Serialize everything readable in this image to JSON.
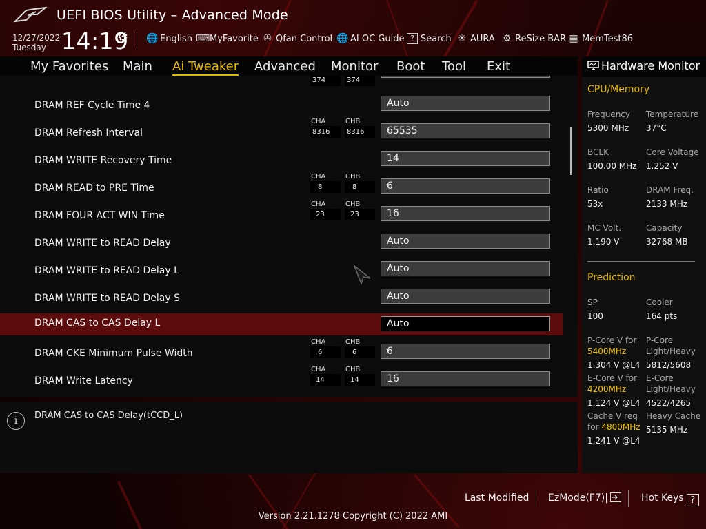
{
  "app": {
    "title": "UEFI BIOS Utility – Advanced Mode"
  },
  "datetime": {
    "date": "12/27/2022",
    "day": "Tuesday",
    "time": "14:19"
  },
  "toolbar": [
    {
      "name": "language",
      "icon": "globe-icon",
      "glyph": "🌐",
      "label": "English"
    },
    {
      "name": "myfavorite",
      "icon": "keyboard-icon",
      "glyph": "⌨",
      "label": "MyFavorite"
    },
    {
      "name": "qfan-control",
      "icon": "fan-icon",
      "glyph": "✇",
      "label": "Qfan Control"
    },
    {
      "name": "ai-oc-guide",
      "icon": "globe-icon",
      "glyph": "🌐",
      "label": "AI OC Guide"
    },
    {
      "name": "search",
      "icon": "question-icon",
      "glyph": "?",
      "label": "Search"
    },
    {
      "name": "aura",
      "icon": "sun-icon",
      "glyph": "☀",
      "label": "AURA"
    },
    {
      "name": "resize-bar",
      "icon": "chip-icon",
      "glyph": "⚙",
      "label": "ReSize BAR"
    },
    {
      "name": "memtest86",
      "icon": "memory-icon",
      "glyph": "▦",
      "label": "MemTest86"
    }
  ],
  "tabs": [
    {
      "label": "My Favorites",
      "active": false
    },
    {
      "label": "Main",
      "active": false
    },
    {
      "label": "Ai Tweaker",
      "active": true
    },
    {
      "label": "Advanced",
      "active": false
    },
    {
      "label": "Monitor",
      "active": false
    },
    {
      "label": "Boot",
      "active": false
    },
    {
      "label": "Tool",
      "active": false
    },
    {
      "label": "Exit",
      "active": false
    }
  ],
  "settings": {
    "partial_top": {
      "cha": "374",
      "chb": "374"
    },
    "channel_labels": {
      "a": "CHA",
      "b": "CHB"
    },
    "rows": [
      {
        "label": "DRAM REF Cycle Time 4",
        "value": "Auto",
        "cha": null,
        "chb": null,
        "selected": false
      },
      {
        "label": "DRAM Refresh Interval",
        "value": "65535",
        "cha": "8316",
        "chb": "8316",
        "selected": false
      },
      {
        "label": "DRAM WRITE Recovery Time",
        "value": "14",
        "cha": null,
        "chb": null,
        "selected": false
      },
      {
        "label": "DRAM READ to PRE Time",
        "value": "6",
        "cha": "8",
        "chb": "8",
        "selected": false
      },
      {
        "label": "DRAM FOUR ACT WIN Time",
        "value": "16",
        "cha": "23",
        "chb": "23",
        "selected": false
      },
      {
        "label": "DRAM WRITE to READ Delay",
        "value": "Auto",
        "cha": null,
        "chb": null,
        "selected": false
      },
      {
        "label": "DRAM WRITE to READ Delay L",
        "value": "Auto",
        "cha": null,
        "chb": null,
        "selected": false
      },
      {
        "label": "DRAM WRITE to READ Delay S",
        "value": "Auto",
        "cha": null,
        "chb": null,
        "selected": false
      },
      {
        "label": "DRAM CAS to CAS Delay L",
        "value": "Auto",
        "cha": null,
        "chb": null,
        "selected": true
      },
      {
        "label": "DRAM CKE Minimum Pulse Width",
        "value": "6",
        "cha": "6",
        "chb": "6",
        "selected": false
      },
      {
        "label": "DRAM Write Latency",
        "value": "16",
        "cha": "14",
        "chb": "14",
        "selected": false
      }
    ]
  },
  "help": {
    "text": "DRAM CAS to CAS Delay(tCCD_L)"
  },
  "hardware_monitor": {
    "title": "Hardware Monitor",
    "cpu_memory": {
      "title": "CPU/Memory",
      "items": [
        {
          "label": "Frequency",
          "value": "5300 MHz"
        },
        {
          "label": "Temperature",
          "value": "37°C"
        },
        {
          "label": "BCLK",
          "value": "100.00 MHz"
        },
        {
          "label": "Core Voltage",
          "value": "1.252 V"
        },
        {
          "label": "Ratio",
          "value": "53x"
        },
        {
          "label": "DRAM Freq.",
          "value": "2133 MHz"
        },
        {
          "label": "MC Volt.",
          "value": "1.190 V"
        },
        {
          "label": "Capacity",
          "value": "32768 MB"
        }
      ]
    },
    "prediction": {
      "title": "Prediction",
      "sp_label": "SP",
      "sp_value": "100",
      "cooler_label": "Cooler",
      "cooler_value": "164 pts",
      "pcore_v_label": "P-Core V for",
      "pcore_v_freq": "5400MHz",
      "pcore_v_value": "1.304 V @L4",
      "pcore_lh_label1": "P-Core",
      "pcore_lh_label2": "Light/Heavy",
      "pcore_lh_value": "5812/5608",
      "ecore_v_label": "E-Core V for",
      "ecore_v_freq": "4200MHz",
      "ecore_v_value": "1.124 V @L4",
      "ecore_lh_label1": "E-Core",
      "ecore_lh_label2": "Light/Heavy",
      "ecore_lh_value": "4522/4265",
      "cache_v_label1": "Cache V req",
      "cache_v_label2": "for",
      "cache_v_freq": "4800MHz",
      "cache_v_value": "1.241 V @L4",
      "heavy_cache_label": "Heavy Cache",
      "heavy_cache_value": "5135 MHz"
    }
  },
  "footer": {
    "last_modified": "Last Modified",
    "ezmode": "EzMode(F7)|",
    "hot_keys": "Hot Keys",
    "hot_keys_icon": "?",
    "version": "Version 2.21.1278 Copyright (C) 2022 AMI"
  },
  "colors": {
    "accent": "#e6b800",
    "selected_row": "#5c0c0c",
    "panel": "#0c0c0c"
  }
}
